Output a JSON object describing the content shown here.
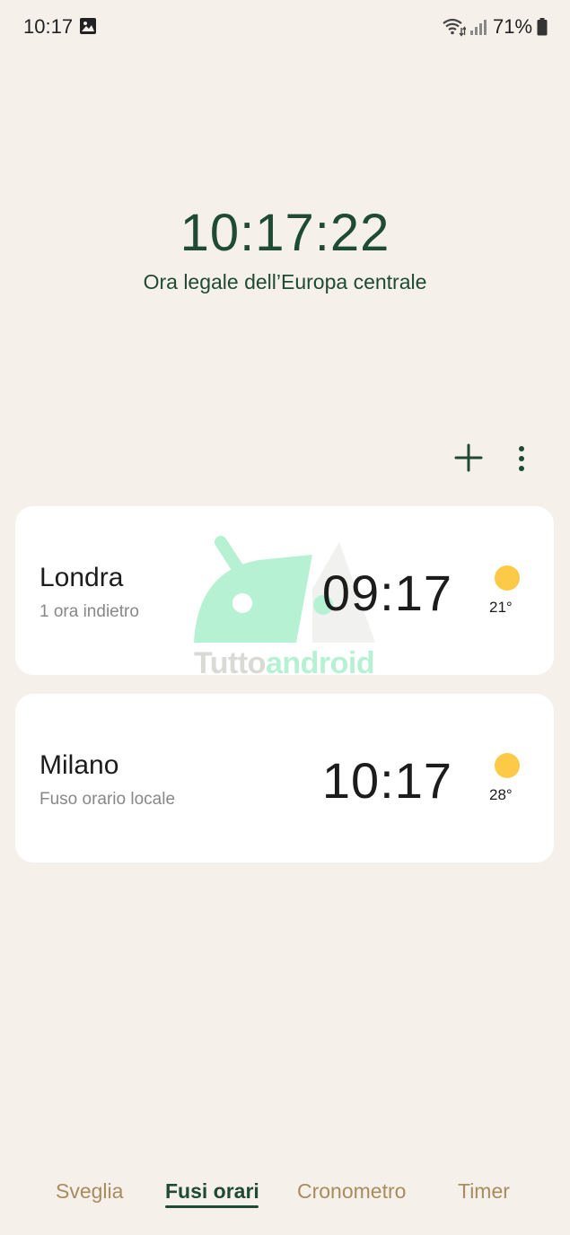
{
  "status_bar": {
    "time": "10:17",
    "battery": "71%",
    "icons": [
      "gallery-icon",
      "wifi-icon",
      "signal-icon",
      "battery-icon"
    ]
  },
  "main_clock": {
    "time": "10:17:22",
    "timezone": "Ora legale dell’Europa centrale"
  },
  "actions": {
    "icons": [
      "add-icon",
      "more-vert-icon"
    ]
  },
  "cities": [
    {
      "name": "Londra",
      "subtitle": "1 ora indietro",
      "time": "09:17",
      "temp": "21°",
      "weather_icon": "sun-icon"
    },
    {
      "name": "Milano",
      "subtitle": "Fuso orario locale",
      "time": "10:17",
      "temp": "28°",
      "weather_icon": "sun-icon"
    }
  ],
  "watermark": {
    "part_a": "Tutto",
    "part_b": "android"
  },
  "tabs": [
    {
      "label": "Sveglia",
      "active": false
    },
    {
      "label": "Fusi orari",
      "active": true
    },
    {
      "label": "Cronometro",
      "active": false
    },
    {
      "label": "Timer",
      "active": false
    }
  ],
  "colors": {
    "background": "#f5f0ea",
    "accent_green": "#1f4a33",
    "tab_inactive": "#a98c5e",
    "sun": "#fdca47",
    "card": "#ffffff"
  }
}
